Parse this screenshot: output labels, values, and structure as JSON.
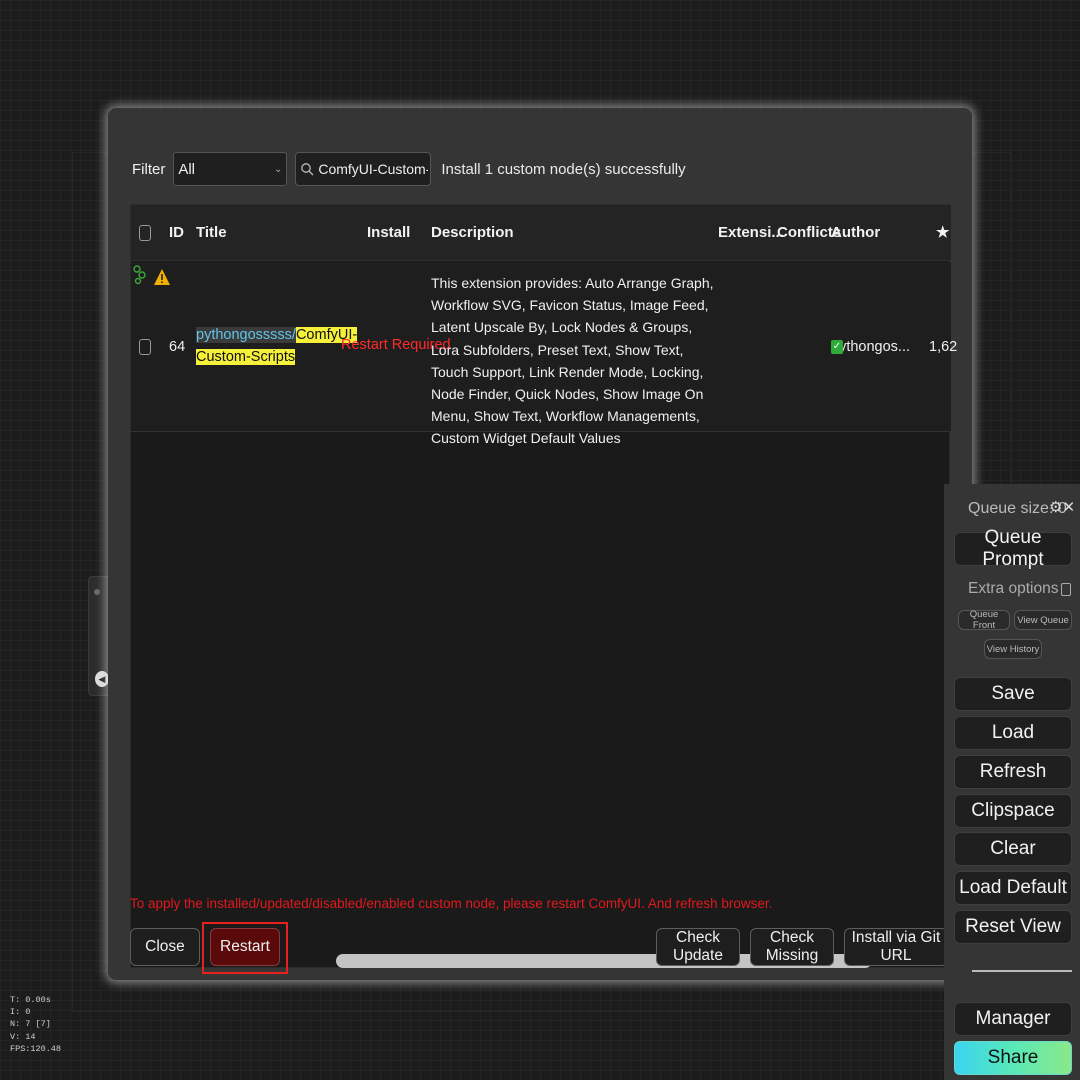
{
  "dialog": {
    "filter_label": "Filter",
    "filter_selected": "All",
    "search_value": "ComfyUI-Custom-Scripts",
    "status_message": "Install 1 custom node(s) successfully",
    "columns": {
      "id": "ID",
      "title": "Title",
      "install": "Install",
      "description": "Description",
      "extensions": "Extensi...",
      "conflicts": "Conflicts",
      "author": "Author",
      "stars": "★"
    },
    "rows": [
      {
        "id": "64",
        "title_owner": "pythongosssss/",
        "title_repo": "ComfyUI-Custom-Scripts",
        "install_status": "Restart Required",
        "description": "This extension provides: Auto Arrange Graph, Workflow SVG, Favicon Status, Image Feed, Latent Upscale By, Lock Nodes & Groups, Lora Subfolders, Preset Text, Show Text, Touch Support, Link Render Mode, Locking, Node Finder, Quick Nodes, Show Image On Menu, Show Text, Workflow Managements, Custom Widget Default Values",
        "author": "pythongos...",
        "stars": "1,62"
      }
    ],
    "restart_note": "To apply the installed/updated/disabled/enabled custom node, please restart ComfyUI. And refresh browser.",
    "buttons": {
      "close": "Close",
      "restart": "Restart",
      "check_update": "Check Update",
      "check_missing": "Check Missing",
      "install_git": "Install via Git URL"
    }
  },
  "side_menu": {
    "queue_size": "Queue size: 0",
    "queue_prompt": "Queue Prompt",
    "extra_options": "Extra options",
    "queue_front": "Queue Front",
    "view_queue": "View Queue",
    "view_history": "View History",
    "save": "Save",
    "load": "Load",
    "refresh": "Refresh",
    "clipspace": "Clipspace",
    "clear": "Clear",
    "load_default": "Load Default",
    "reset_view": "Reset View",
    "manager": "Manager",
    "share": "Share"
  },
  "stats": {
    "t": "T: 0.00s",
    "i": "I: 0",
    "n": "N: 7 [7]",
    "v": "V: 14",
    "fps": "FPS:120.48"
  },
  "colors": {
    "restart_required": "#ff2a2a",
    "owner_link": "#5fc4e8",
    "repo_highlight": "#f5f03a",
    "restart_button": "#5a0a0a"
  },
  "icons": [
    "search-icon",
    "extension-link-icon",
    "warning-icon",
    "verified-check-icon",
    "gear-icon",
    "close-icon",
    "collapse-arrow-icon",
    "star-icon"
  ]
}
